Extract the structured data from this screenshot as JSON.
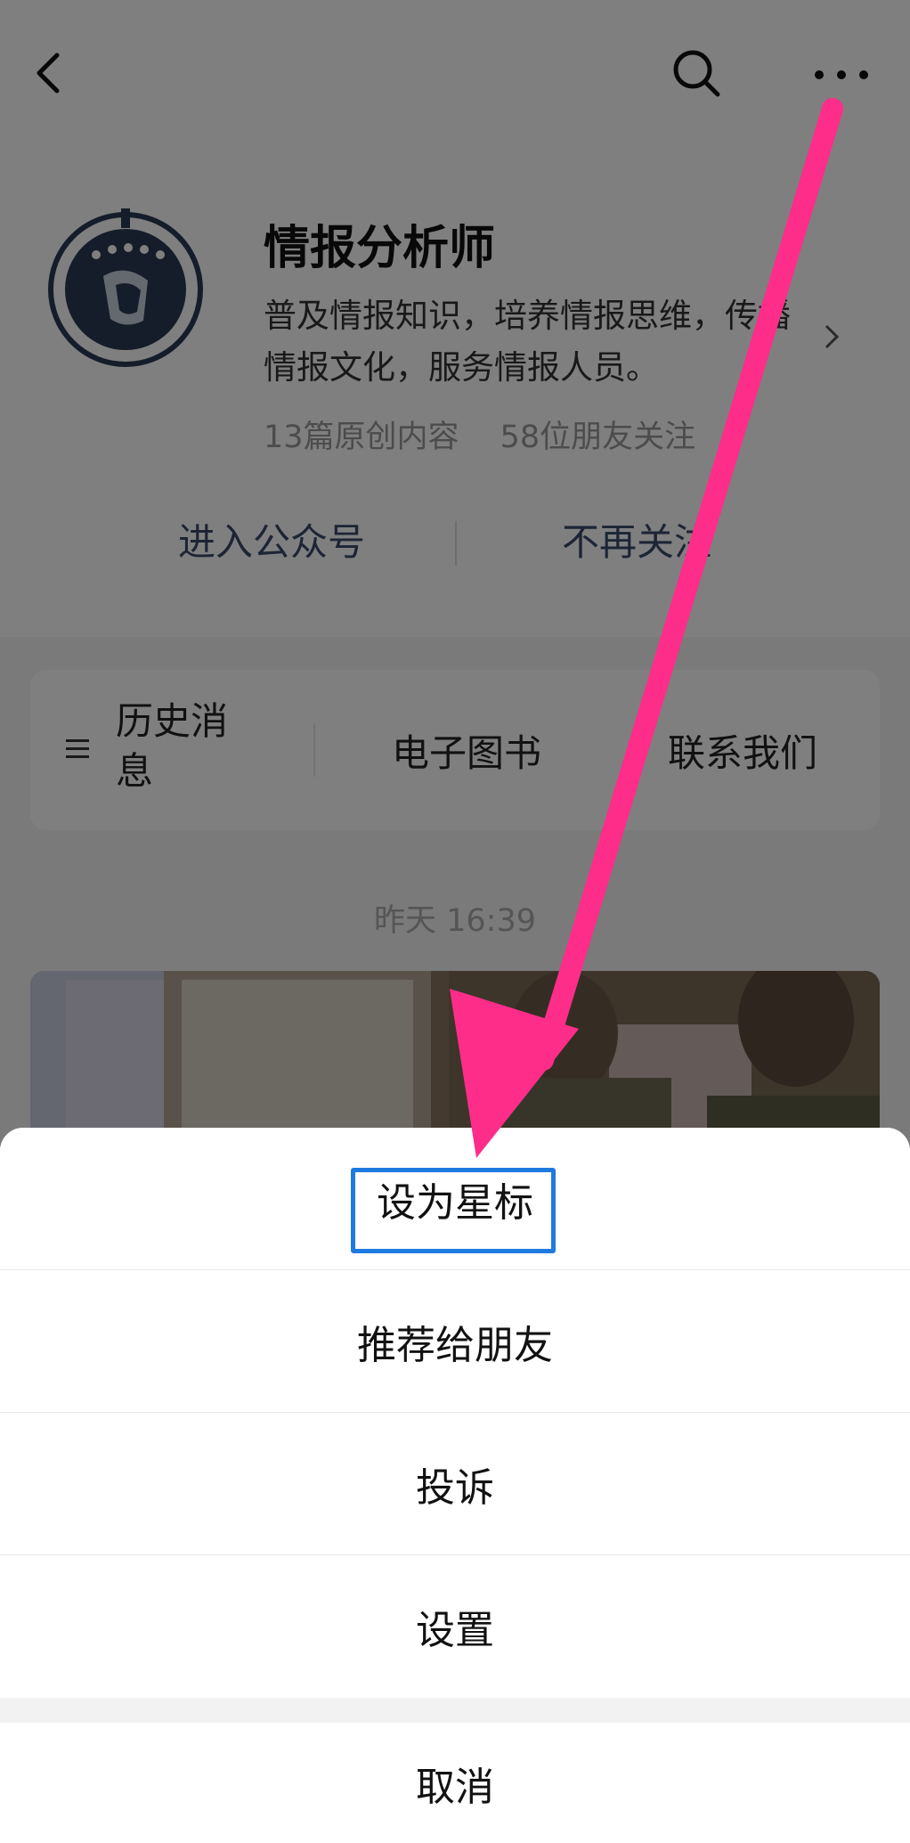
{
  "account": {
    "name": "情报分析师",
    "description": "普及情报知识，培养情报思维，传播情报文化，服务情报人员。",
    "original_count": "13篇原创内容",
    "friends_following": "58位朋友关注"
  },
  "actions": {
    "enter": "进入公众号",
    "unfollow": "不再关注"
  },
  "menu": {
    "history": "历史消息",
    "ebook": "电子图书",
    "contact": "联系我们"
  },
  "feed": {
    "timestamp": "昨天 16:39"
  },
  "sheet": {
    "star": "设为星标",
    "recommend": "推荐给朋友",
    "complain": "投诉",
    "settings": "设置",
    "cancel": "取消"
  },
  "icons": {
    "back": "back-arrow-icon",
    "search": "search-icon",
    "more": "more-dots-icon",
    "chevron": "chevron-right-icon",
    "list": "list-icon"
  },
  "colors": {
    "highlight": "#1f7ae0",
    "annotation_arrow": "#ff2d8a",
    "link_text": "#3a4a6b"
  }
}
